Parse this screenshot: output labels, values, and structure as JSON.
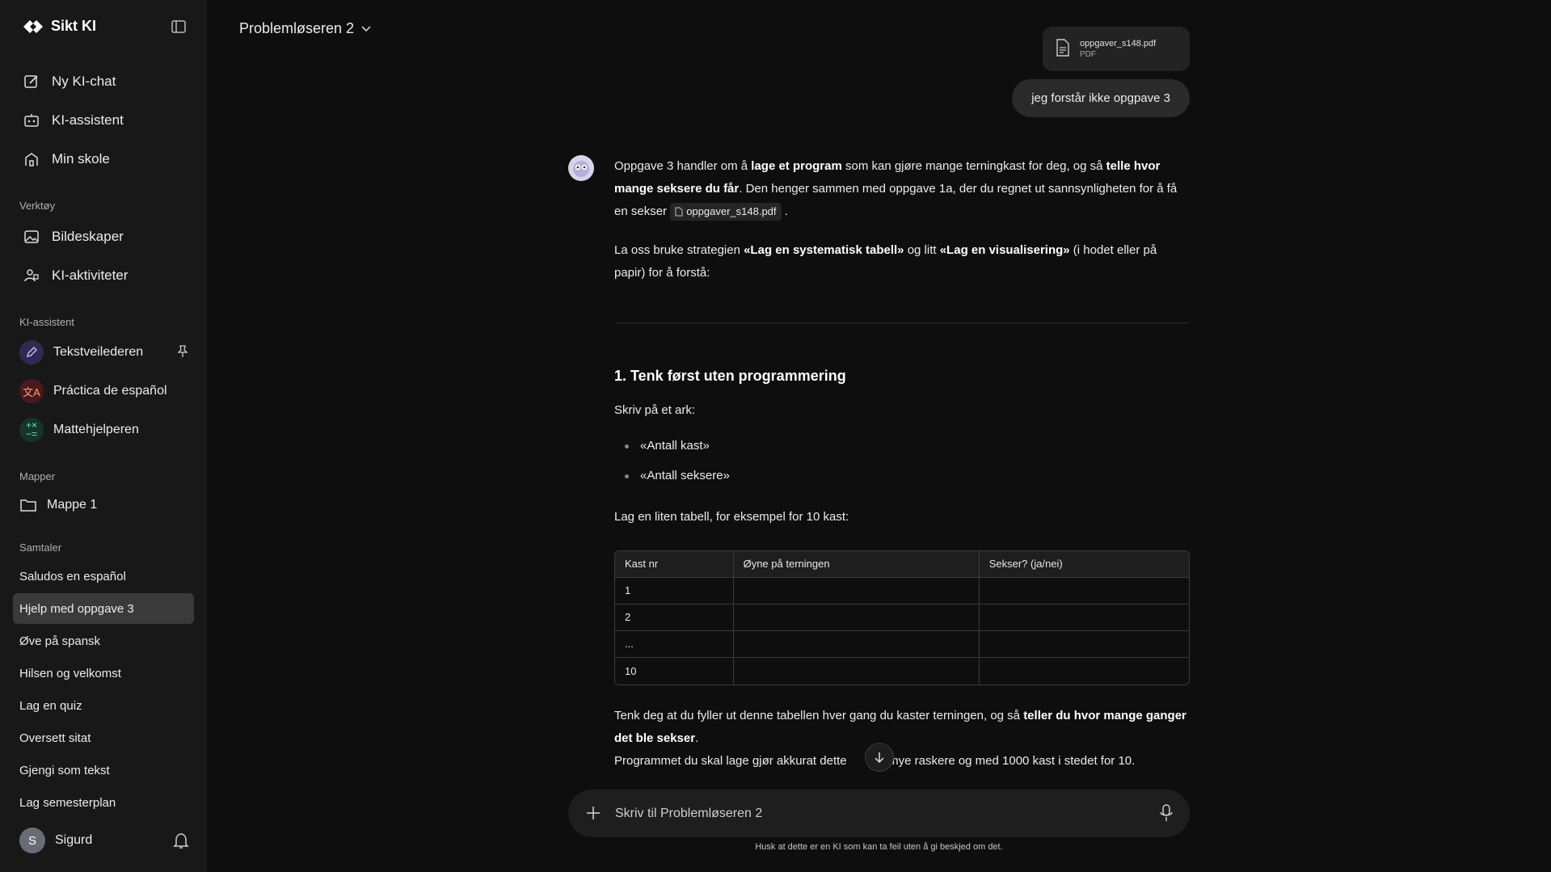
{
  "brand": {
    "name": "Sikt KI"
  },
  "nav": {
    "new_chat": "Ny KI-chat",
    "assistant": "KI-assistent",
    "school": "Min skole"
  },
  "tools": {
    "label": "Verktøy",
    "image_creator": "Bildeskaper",
    "activities": "KI-aktiviteter"
  },
  "assistants": {
    "label": "KI-assistent",
    "items": [
      {
        "name": "Tekstveilederen"
      },
      {
        "name": "Práctica de español"
      },
      {
        "name": "Mattehjelperen"
      }
    ]
  },
  "folders": {
    "label": "Mapper",
    "items": [
      {
        "name": "Mappe 1"
      }
    ]
  },
  "conversations": {
    "label": "Samtaler",
    "items": [
      {
        "title": "Saludos en español"
      },
      {
        "title": "Hjelp med oppgave 3"
      },
      {
        "title": "Øve på spansk"
      },
      {
        "title": "Hilsen og velkomst"
      },
      {
        "title": "Lag en quiz"
      },
      {
        "title": "Oversett sitat"
      },
      {
        "title": "Gjengi som tekst"
      },
      {
        "title": "Lag semesterplan"
      }
    ],
    "active_index": 1
  },
  "user": {
    "initial": "S",
    "name": "Sigurd"
  },
  "header": {
    "assistant_name": "Problemløseren 2"
  },
  "attachment": {
    "filename": "oppgaver_s148.pdf",
    "type": "PDF"
  },
  "user_message": "jeg forstår ikke opgpave 3",
  "answer": {
    "p1_a": "Oppgave 3 handler om å ",
    "p1_b": "lage et program",
    "p1_c": " som kan gjøre mange terningkast for deg, og så ",
    "p1_d": "telle hvor mange seksere du får",
    "p1_e": ". Den henger sammen med oppgave 1a, der du regnet ut sannsynligheten for å få en sekser ",
    "p1_file": "oppgaver_s148.pdf",
    "p1_f": " .",
    "p2_a": "La oss bruke strategien ",
    "p2_b": "«Lag en systematisk tabell»",
    "p2_c": " og litt ",
    "p2_d": "«Lag en visualisering»",
    "p2_e": " (i hodet eller på papir) for å forstå:",
    "heading": "1. Tenk først uten programmering",
    "write_on": "Skriv på et ark:",
    "bullets": [
      "«Antall kast»",
      "«Antall seksere»"
    ],
    "table_intro": "Lag en liten tabell, for eksempel for 10 kast:",
    "table": {
      "headers": [
        "Kast nr",
        "Øyne på terningen",
        "Sekser? (ja/nei)"
      ],
      "rows": [
        [
          "1",
          "",
          ""
        ],
        [
          "2",
          "",
          ""
        ],
        [
          "...",
          "",
          ""
        ],
        [
          "10",
          "",
          ""
        ]
      ]
    },
    "p3_a": "Tenk deg at du fyller ut denne tabellen hver gang du kaster terningen, og så ",
    "p3_b": "teller du hvor mange ganger det ble sekser",
    "p3_c": ".",
    "p4_a": "Programmet du skal lage gjør akkurat dette",
    "p4_b": "re mye raskere og med 1000 kast i stedet for 10."
  },
  "composer": {
    "placeholder": "Skriv til Problemløseren 2"
  },
  "disclaimer": "Husk at dette er en KI som kan ta feil uten å gi beskjed om det."
}
